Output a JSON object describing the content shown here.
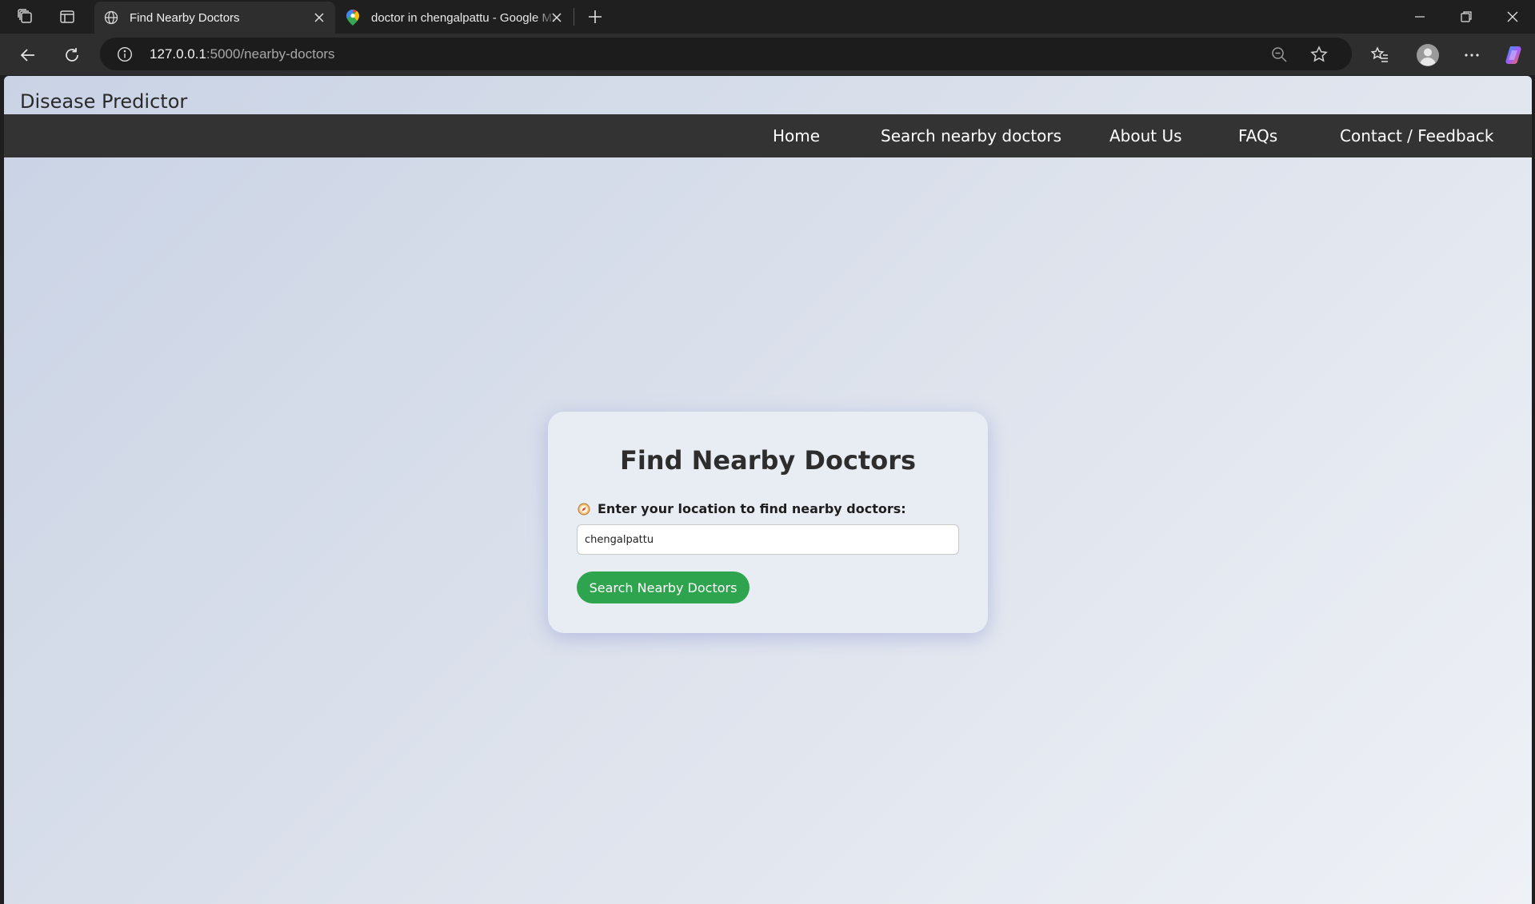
{
  "browser": {
    "tabs": [
      {
        "title": "Find Nearby Doctors",
        "active": true,
        "icon": "globe-icon"
      },
      {
        "title": "doctor in chengalpattu - Google Maps",
        "active": false,
        "icon": "maps-pin-icon"
      }
    ],
    "address": {
      "host": "127.0.0.1",
      "path": ":5000/nearby-doctors"
    }
  },
  "site": {
    "brand": "Disease Predictor",
    "nav": [
      "Home",
      "Search nearby doctors",
      "About Us",
      "FAQs",
      "Contact / Feedback"
    ]
  },
  "card": {
    "title": "Find Nearby Doctors",
    "label": "Enter your location to find nearby doctors:",
    "input_value": "chengalpattu",
    "button": "Search Nearby Doctors"
  },
  "colors": {
    "button": "#2ea44f",
    "navbar": "#333333",
    "browser_chrome": "#1f1f1f"
  }
}
